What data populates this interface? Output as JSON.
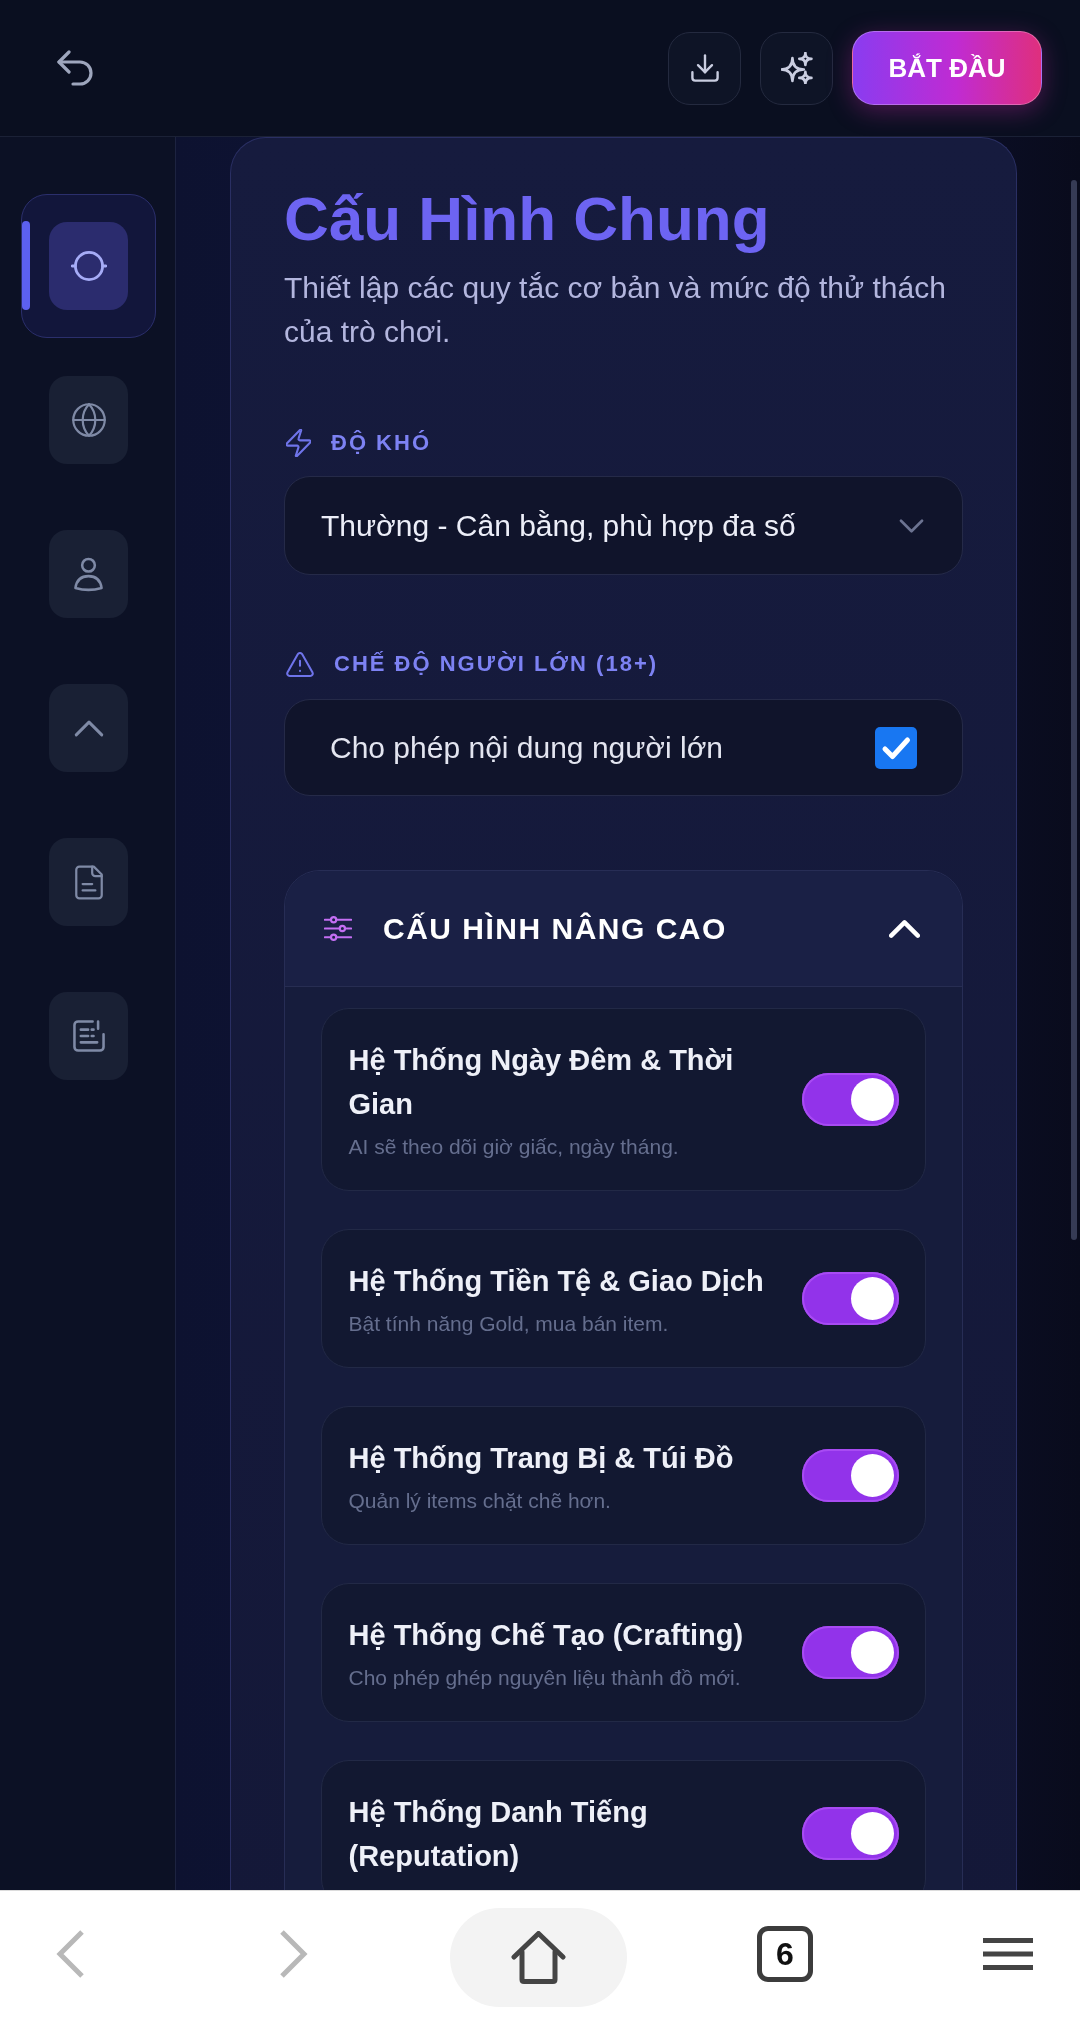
{
  "top_bar": {
    "start_button": "BẮT ĐẦU"
  },
  "sidebar": {
    "items": [
      {
        "selected": true
      },
      {
        "selected": false
      },
      {
        "selected": false
      },
      {
        "selected": false
      },
      {
        "selected": false
      },
      {
        "selected": false
      }
    ]
  },
  "card": {
    "title": "Cấu Hình Chung",
    "subtitle": "Thiết lập các quy tắc cơ bản và mức độ thử thách của trò chơi.",
    "difficulty": {
      "label": "ĐỘ KHÓ",
      "value": "Thường - Cân bằng, phù hợp đa số"
    },
    "adult_mode": {
      "label": "CHẾ ĐỘ NGƯỜI LỚN (18+)",
      "option": "Cho phép nội dung người lớn",
      "checked": true
    },
    "advanced": {
      "title": "CẤU HÌNH NÂNG CAO",
      "expanded": true,
      "toggles": [
        {
          "title": "Hệ Thống Ngày Đêm & Thời Gian",
          "description": "AI sẽ theo dõi giờ giấc, ngày tháng.",
          "on": true
        },
        {
          "title": "Hệ Thống Tiền Tệ & Giao Dịch",
          "description": "Bật tính năng Gold, mua bán item.",
          "on": true
        },
        {
          "title": "Hệ Thống Trang Bị & Túi Đồ",
          "description": "Quản lý items chặt chẽ hơn.",
          "on": true
        },
        {
          "title": "Hệ Thống Chế Tạo (Crafting)",
          "description": "Cho phép ghép nguyên liệu thành đồ mới.",
          "on": true
        },
        {
          "title": "Hệ Thống Danh Tiếng (Reputation)",
          "on": true
        }
      ]
    }
  },
  "browser_bar": {
    "back_disabled": true,
    "forward_disabled": true,
    "tab_count": "6"
  }
}
